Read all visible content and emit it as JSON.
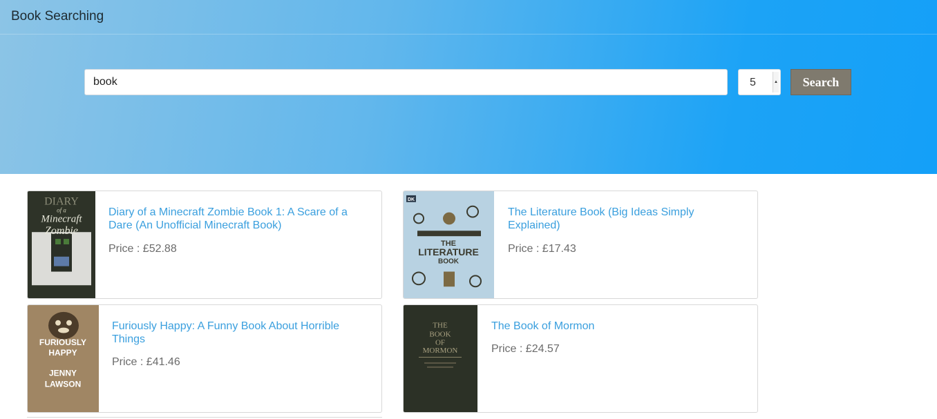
{
  "navbar": {
    "brand": "Book Searching"
  },
  "search": {
    "query": "book",
    "count_selected": "5",
    "button_label": "Search"
  },
  "results": [
    {
      "title": "Diary of a Minecraft Zombie Book 1: A Scare of a Dare (An Unofficial Minecraft Book)",
      "price": "Price : £52.88"
    },
    {
      "title": "The Literature Book (Big Ideas Simply Explained)",
      "price": "Price : £17.43"
    },
    {
      "title": "Furiously Happy: A Funny Book About Horrible Things",
      "price": "Price : £41.46"
    },
    {
      "title": "The Book of Mormon",
      "price": "Price : £24.57"
    }
  ],
  "covers": {
    "minecraft": {
      "line1": "DIARY",
      "line2": "of a",
      "line3": "Minecraft",
      "line4": "Zombie"
    },
    "literature": {
      "line1": "THE",
      "line2": "LITERATURE",
      "line3": "BOOK",
      "publisher": "DK"
    },
    "furiously": {
      "line1": "FURIOUSLY",
      "line2": "HAPPY",
      "line3": "JENNY",
      "line4": "LAWSON"
    },
    "mormon": {
      "line1": "THE",
      "line2": "BOOK",
      "line3": "OF",
      "line4": "MORMON"
    }
  },
  "colors": {
    "link": "#3a9fde",
    "price": "#6b6b6b",
    "button": "#7f7a6e",
    "hero_start": "#8cc4e6",
    "hero_end": "#14a0f8"
  }
}
